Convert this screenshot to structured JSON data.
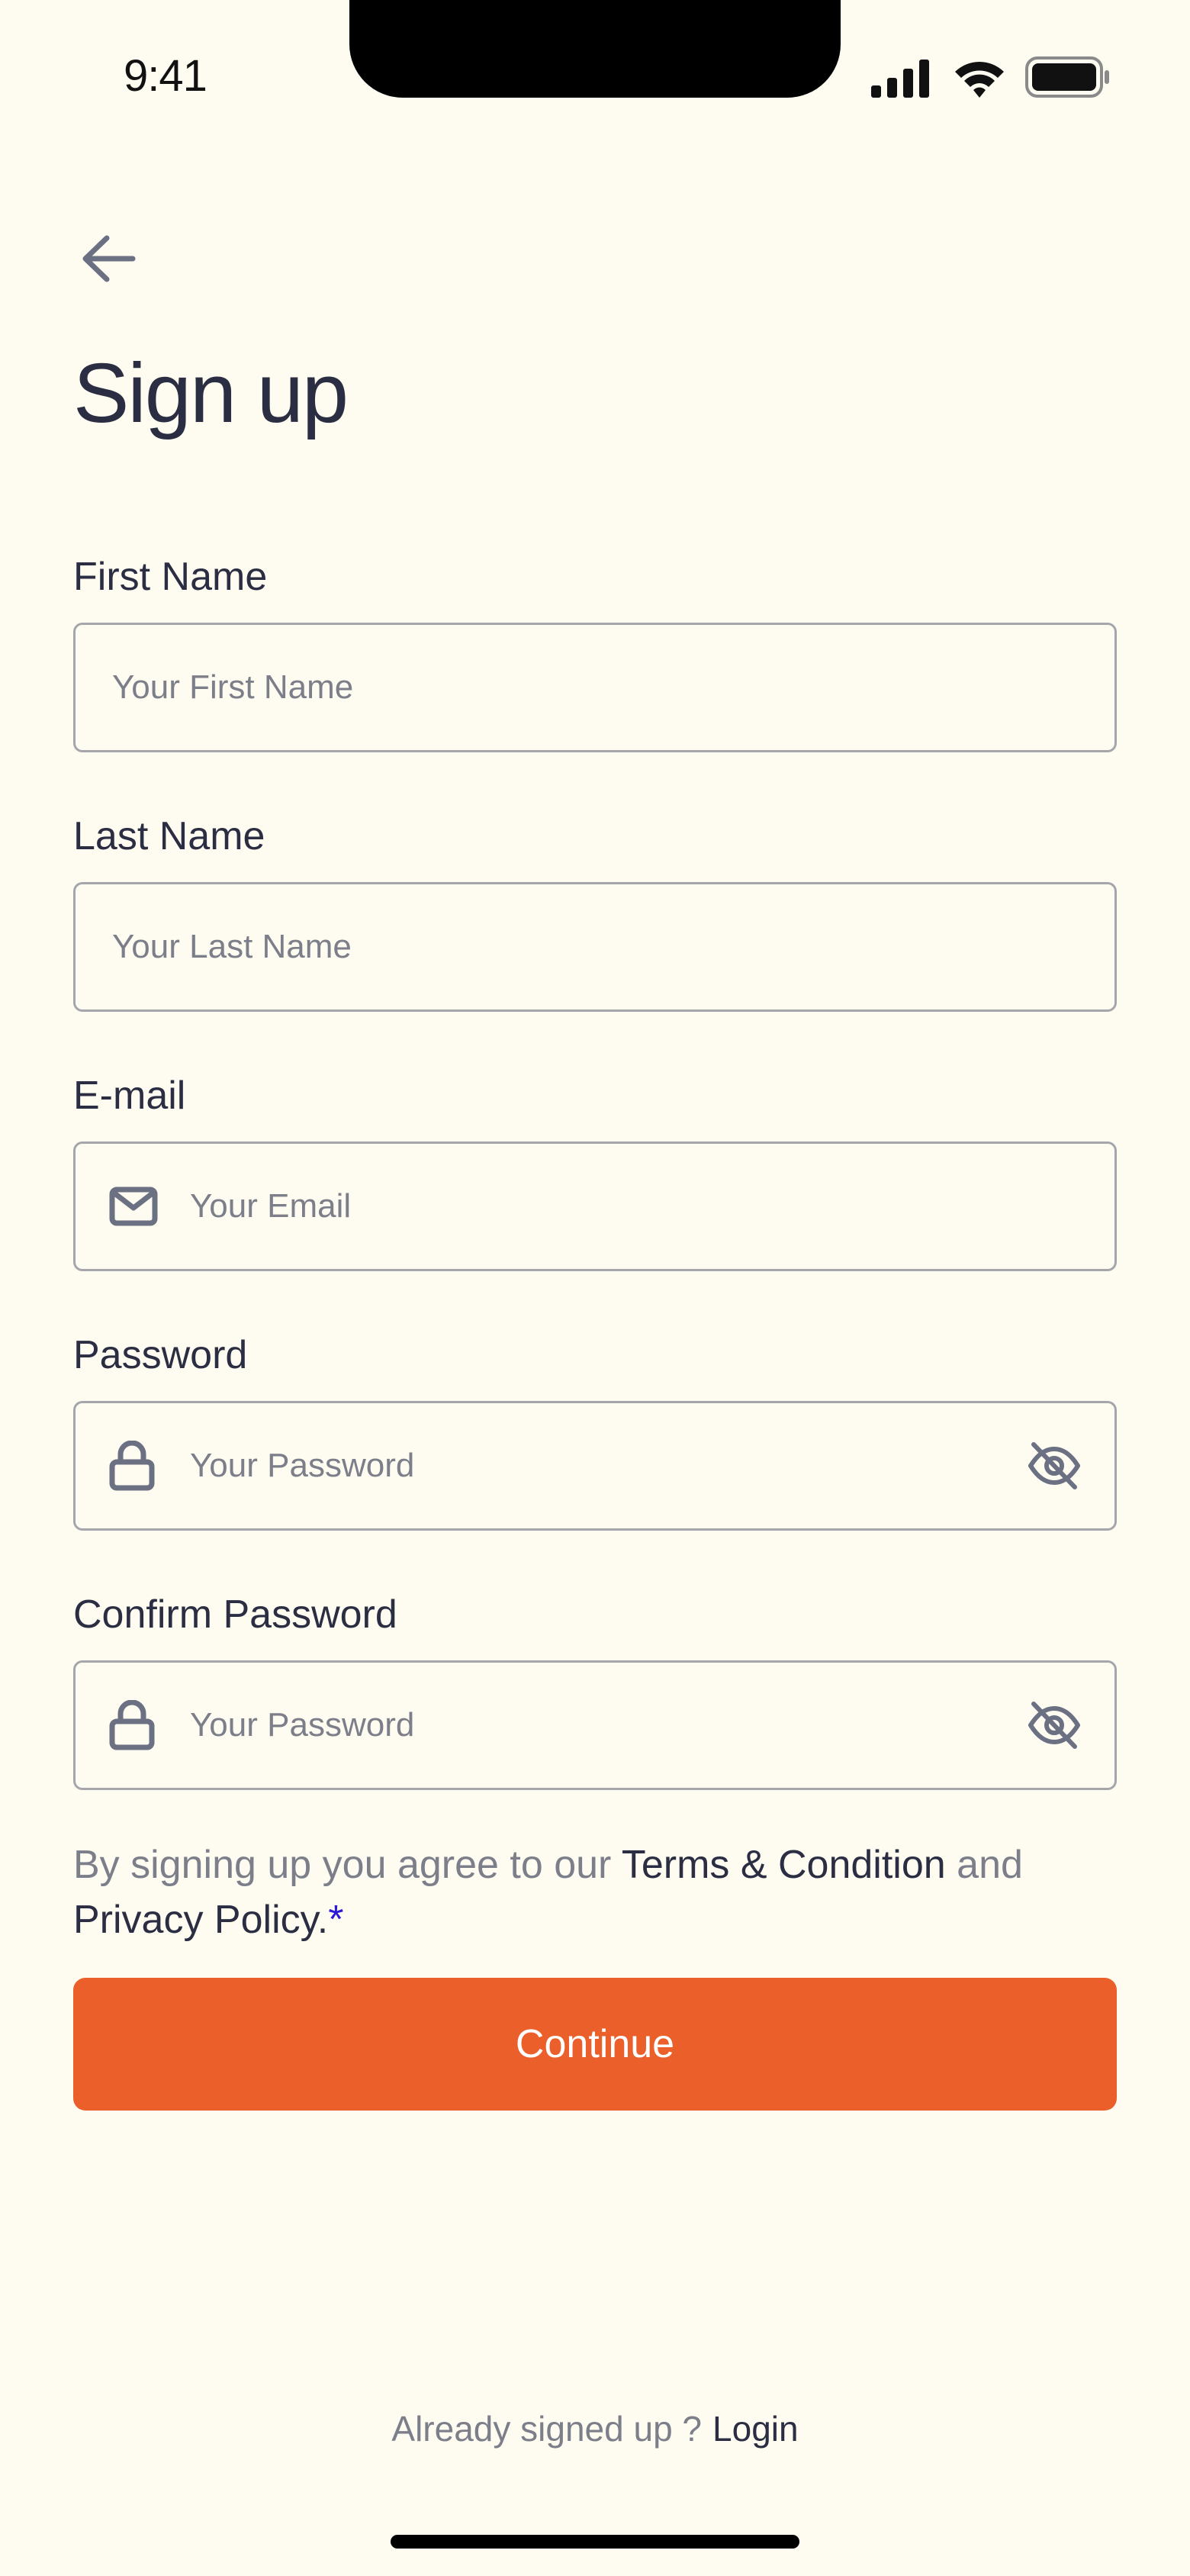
{
  "status_bar": {
    "time": "9:41"
  },
  "header": {
    "title": "Sign up"
  },
  "form": {
    "first_name": {
      "label": "First Name",
      "placeholder": "Your First Name",
      "value": ""
    },
    "last_name": {
      "label": "Last Name",
      "placeholder": "Your Last Name",
      "value": ""
    },
    "email": {
      "label": "E-mail",
      "placeholder": "Your Email",
      "value": "",
      "icon": "mail-icon"
    },
    "password": {
      "label": "Password",
      "placeholder": "Your Password",
      "value": "",
      "icon": "lock-icon",
      "toggle_icon": "eye-off-icon"
    },
    "confirm_password": {
      "label": "Confirm Password",
      "placeholder": "Your Password",
      "value": "",
      "icon": "lock-icon",
      "toggle_icon": "eye-off-icon"
    }
  },
  "agreement": {
    "prefix": "By signing up you agree to our ",
    "terms_link": "Terms & Condition",
    "conjunction": " and ",
    "privacy_link": "Privacy Policy.",
    "required_mark": "*"
  },
  "actions": {
    "continue_label": "Continue"
  },
  "footer": {
    "prompt": "Already signed up ?",
    "login_label": "Login"
  },
  "colors": {
    "background": "#FEFCF0",
    "primary_button": "#EA5F2A",
    "text_primary": "#2B2D42",
    "text_muted": "#7C7E8A",
    "required_mark": "#2B18D8"
  }
}
